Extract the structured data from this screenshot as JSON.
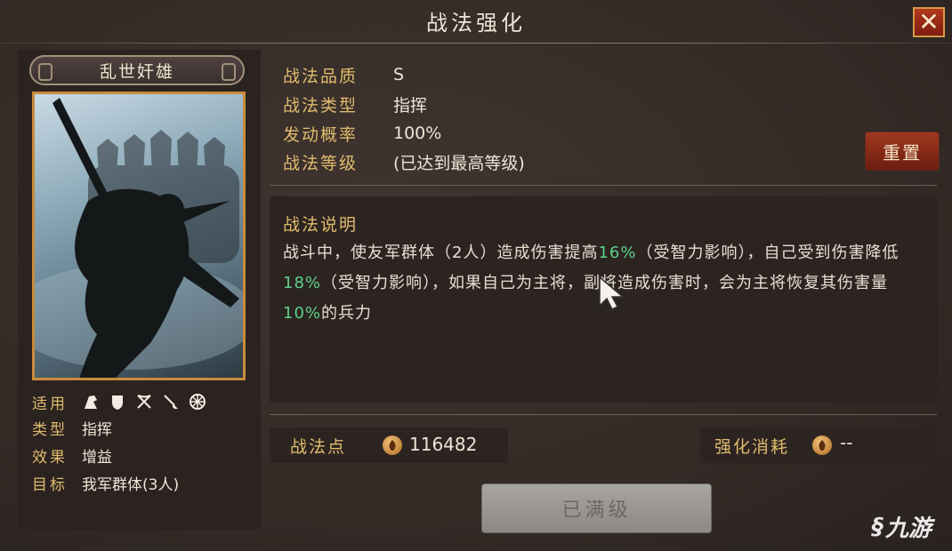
{
  "window": {
    "title": "战法强化",
    "close_icon": "close-icon"
  },
  "tactic": {
    "name": "乱世奸雄",
    "attributes": {
      "applicable_label": "适用",
      "applicable_units": [
        "cavalry-icon",
        "shield-icon",
        "bow-icon",
        "spear-icon",
        "siege-icon"
      ],
      "type_label": "类型",
      "type_value": "指挥",
      "effect_label": "效果",
      "effect_value": "增益",
      "target_label": "目标",
      "target_value": "我军群体(3人)"
    }
  },
  "info": {
    "quality_label": "战法品质",
    "quality_value": "S",
    "kind_label": "战法类型",
    "kind_value": "指挥",
    "rate_label": "发动概率",
    "rate_value": "100%",
    "level_label": "战法等级",
    "level_value": "(已达到最高等级)"
  },
  "reset_button": "重置",
  "description": {
    "title": "战法说明",
    "seg1": "战斗中，使友军群体（2人）造成伤害提高",
    "hl1": "16%",
    "seg2": "（受智力影响），自己受到伤害降低",
    "hl2": "18%",
    "seg3": "（受智力影响），如果自己为主将，副将造成伤害时，会为主将恢复其伤害量",
    "hl3": "10%",
    "seg4": "的兵力"
  },
  "points": {
    "label": "战法点",
    "value": "116482"
  },
  "cost": {
    "label": "强化消耗",
    "value": "--"
  },
  "max_button": "已满级",
  "watermark": "九游",
  "colors": {
    "accent_gold": "#e0bb6e",
    "highlight_green": "#5fd08a",
    "button_red": "#a0391f"
  }
}
